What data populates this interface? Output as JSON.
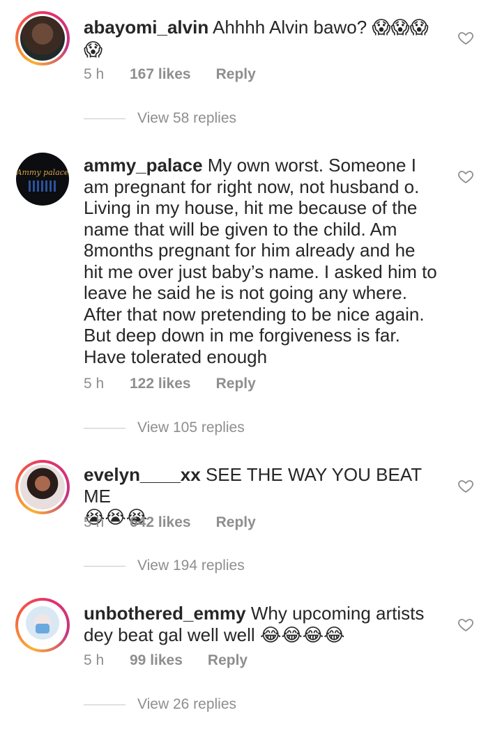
{
  "comments": [
    {
      "username": "abayomi_alvin",
      "text": "Ahhhh Alvin bawo?",
      "emoji": "😱😱😱😱",
      "time": "5 h",
      "likes": "167 likes",
      "reply": "Reply",
      "view_replies": "View 58 replies"
    },
    {
      "username": "ammy_palace",
      "text": "My own worst. Someone I am pregnant for right now, not husband o. Living in my house, hit me because of the name that will be given to the child. Am 8months pregnant for him already and he hit me over just baby’s name. I asked him to leave he said he is not going any where. After that now pretending to be nice again. But deep down in me forgiveness is far. Have tolerated enough",
      "avatar_logo_text": "Ammy palace",
      "time": "5 h",
      "likes": "122 likes",
      "reply": "Reply",
      "view_replies": "View 105 replies"
    },
    {
      "username": "evelyn____xx",
      "text": "SEE THE WAY YOU BEAT ME",
      "emoji": "😭😭😭",
      "time": "5 h",
      "likes": "642 likes",
      "reply": "Reply",
      "view_replies": "View 194 replies"
    },
    {
      "username": "unbothered_emmy",
      "text": "Why upcoming artists dey beat gal well well",
      "emoji": "😂😂😂😂",
      "time": "5 h",
      "likes": "99 likes",
      "reply": "Reply",
      "view_replies": "View 26 replies"
    }
  ],
  "icons": {
    "like": "heart-outline-icon"
  },
  "colors": {
    "meta_gray": "#8e8e8e",
    "text": "#262626",
    "story_ring": "#e1306c"
  }
}
